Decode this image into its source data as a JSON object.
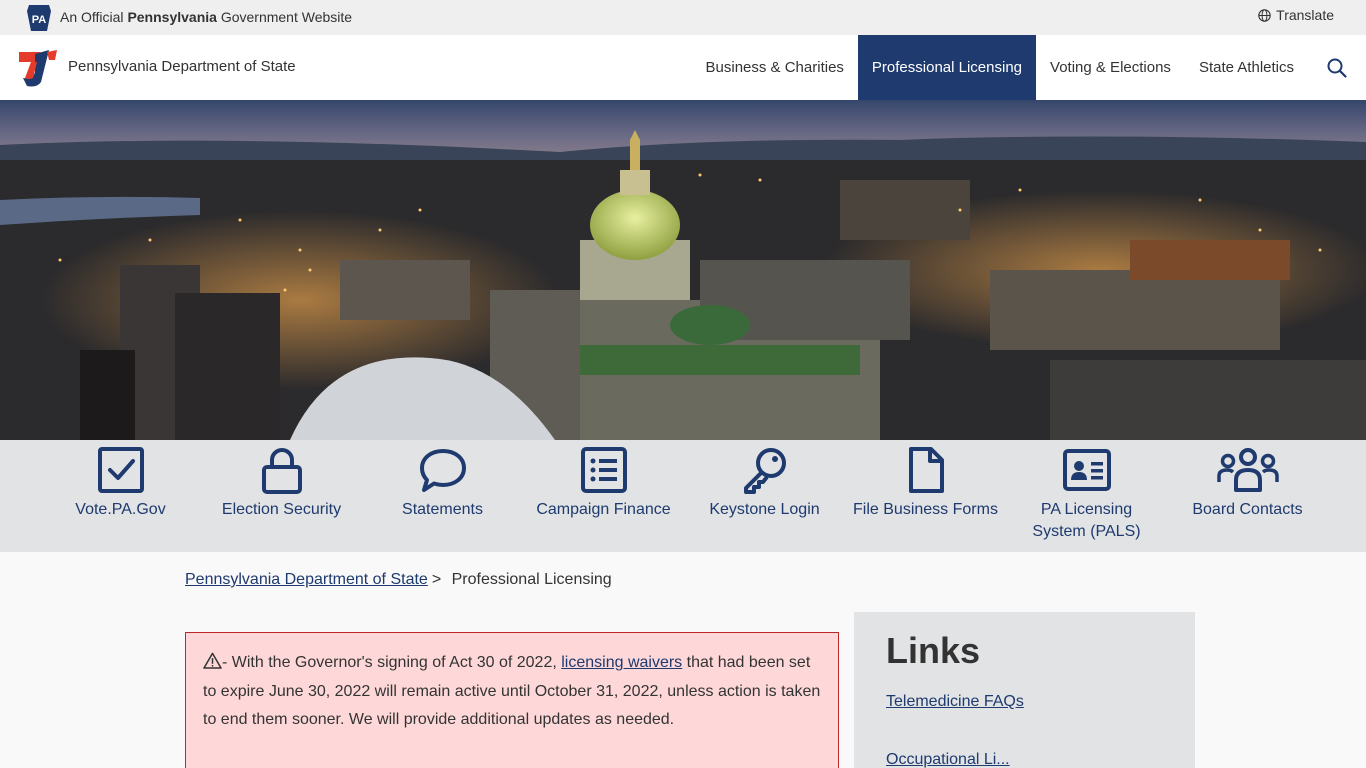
{
  "official_bar": {
    "badge_text": "PA",
    "text_before": "An Official ",
    "text_bold": "Pennsylvania",
    "text_after": " Government Website",
    "translate_label": "Translate"
  },
  "header": {
    "site_name": "Pennsylvania Department of State",
    "nav": [
      {
        "label": "Business & Charities"
      },
      {
        "label": "Professional Licensing"
      },
      {
        "label": "Voting & Elections"
      },
      {
        "label": "State Athletics"
      }
    ]
  },
  "quick_links": [
    {
      "label": "Vote.PA.Gov",
      "icon": "checkbox-icon"
    },
    {
      "label": "Election Security",
      "icon": "lock-icon"
    },
    {
      "label": "Statements",
      "icon": "speech-bubble-icon"
    },
    {
      "label": "Campaign Finance",
      "icon": "list-icon"
    },
    {
      "label": "Keystone Login",
      "icon": "key-icon"
    },
    {
      "label": "File Business Forms",
      "icon": "document-icon"
    },
    {
      "label": "PA Licensing System (PALS)",
      "icon": "id-card-icon"
    },
    {
      "label": "Board Contacts",
      "icon": "people-group-icon"
    }
  ],
  "breadcrumb": {
    "home": "Pennsylvania Department of State",
    "separator": ">",
    "current": "Professional Licensing"
  },
  "alert": {
    "prefix": "- With the Governor's signing of Act 30 of 2022, ",
    "link": "licensing waivers",
    "suffix": " that had been set to expire June 30, 2022 will remain active until October 31, 2022, unless action is taken to end them sooner. We will provide additional updates as needed."
  },
  "links_panel": {
    "title": "Links",
    "items": [
      "Telemedicine FAQs",
      "Occupational Li..."
    ]
  },
  "colors": {
    "brand_navy": "#1e3a6e",
    "alert_bg": "#fed8d8",
    "alert_border": "#c0272d",
    "logo_red": "#e43b2a"
  }
}
